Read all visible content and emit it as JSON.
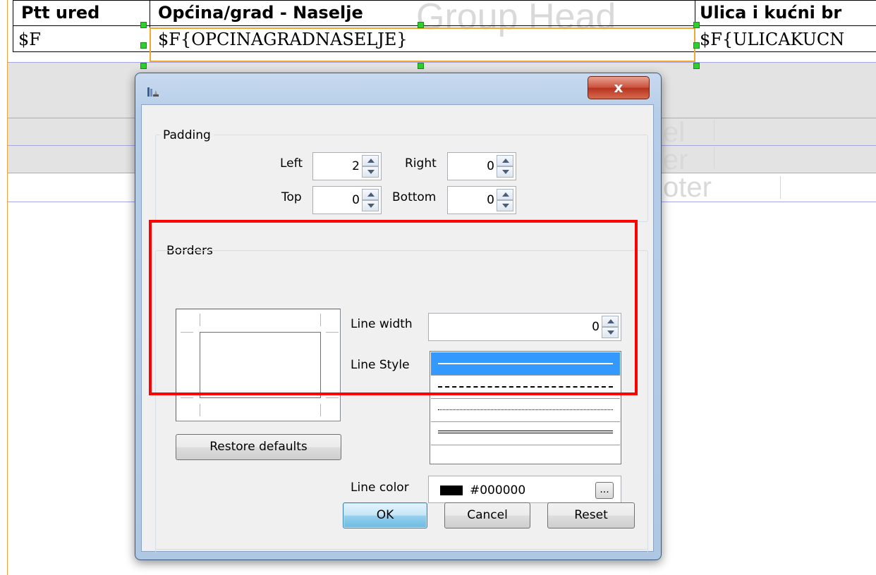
{
  "report": {
    "columns": {
      "header": [
        "Ptt ured",
        "Općina/grad - Naselje",
        "Ulica i kućni br"
      ],
      "detail": [
        "$F",
        "$F{OPCINAGRADNASELJE}",
        "$F{ULICAKUCN"
      ]
    },
    "ghost_labels": {
      "column_header": "Group Head",
      "band_a": "el",
      "band_b": "er",
      "footer": "oter"
    }
  },
  "dialog": {
    "close_label": "x",
    "padding": {
      "title": "Padding",
      "left_label": "Left",
      "left_value": "2",
      "right_label": "Right",
      "right_value": "0",
      "top_label": "Top",
      "top_value": "0",
      "bottom_label": "Bottom",
      "bottom_value": "0"
    },
    "borders": {
      "title": "Borders",
      "line_width_label": "Line width",
      "line_width_value": "0",
      "line_style_label": "Line Style",
      "line_styles": [
        "solid",
        "dashed",
        "dotted",
        "double",
        "none"
      ],
      "selected_style": "solid",
      "line_color_label": "Line color",
      "line_color_value": "#000000",
      "color_swatch": "#000000",
      "more_button": "...",
      "restore_defaults": "Restore defaults"
    },
    "buttons": {
      "ok": "OK",
      "cancel": "Cancel",
      "reset": "Reset"
    }
  },
  "colors": {
    "selection_border": "#f0a830",
    "handle": "#2fce2f",
    "highlight": "#ff0000",
    "list_selection": "#3399ff",
    "close_button": "#c9503a"
  }
}
